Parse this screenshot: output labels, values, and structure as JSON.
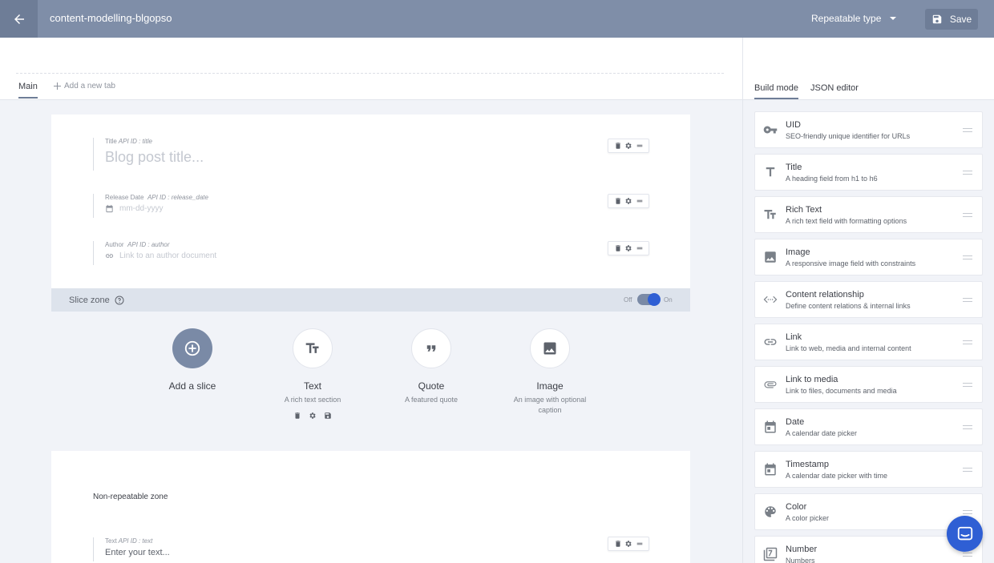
{
  "header": {
    "doc_title": "content-modelling-blgopso",
    "type_label": "Repeatable type",
    "save_label": "Save"
  },
  "tabs": {
    "main_label": "Main",
    "add_label": "Add a new tab"
  },
  "fields": [
    {
      "name": "Title",
      "api": "API ID : title",
      "placeholder": "Blog post title..."
    },
    {
      "name": "Release Date",
      "api": "API ID : release_date",
      "placeholder": "mm-dd-yyyy"
    },
    {
      "name": "Author",
      "api": "API ID : author",
      "placeholder": "Link to an author document"
    }
  ],
  "slice_zone": {
    "label": "Slice zone",
    "off_label": "Off",
    "on_label": "On",
    "toggle_on": true,
    "slices": [
      {
        "name": "Add a slice",
        "desc": ""
      },
      {
        "name": "Text",
        "desc": "A rich text section"
      },
      {
        "name": "Quote",
        "desc": "A featured quote"
      },
      {
        "name": "Image",
        "desc": "An image with optional caption"
      }
    ]
  },
  "non_repeatable": {
    "label": "Non-repeatable zone",
    "field": {
      "name": "Text",
      "api": "API ID : text",
      "placeholder": "Enter your text..."
    }
  },
  "sidebar": {
    "tab_build": "Build mode",
    "tab_json": "JSON editor",
    "items": [
      {
        "icon": "key-icon",
        "name": "UID",
        "desc": "SEO-friendly unique identifier for URLs"
      },
      {
        "icon": "title-t-icon",
        "name": "Title",
        "desc": "A heading field from h1 to h6"
      },
      {
        "icon": "rich-text-icon",
        "name": "Rich Text",
        "desc": "A rich text field with formatting options"
      },
      {
        "icon": "image-icon",
        "name": "Image",
        "desc": "A responsive image field with constraints"
      },
      {
        "icon": "code-relationship-icon",
        "name": "Content relationship",
        "desc": "Define content relations & internal links"
      },
      {
        "icon": "link-icon",
        "name": "Link",
        "desc": "Link to web, media and internal content"
      },
      {
        "icon": "paperclip-icon",
        "name": "Link to media",
        "desc": "Link to files, documents and media"
      },
      {
        "icon": "calendar-icon",
        "name": "Date",
        "desc": "A calendar date picker"
      },
      {
        "icon": "calendar-clock-icon",
        "name": "Timestamp",
        "desc": "A calendar date picker with time"
      },
      {
        "icon": "palette-icon",
        "name": "Color",
        "desc": "A color picker"
      },
      {
        "icon": "number-icon",
        "name": "Number",
        "desc": "Numbers"
      }
    ]
  },
  "colors": {
    "header": "#7f8ea8",
    "accent": "#2f5fd4"
  }
}
